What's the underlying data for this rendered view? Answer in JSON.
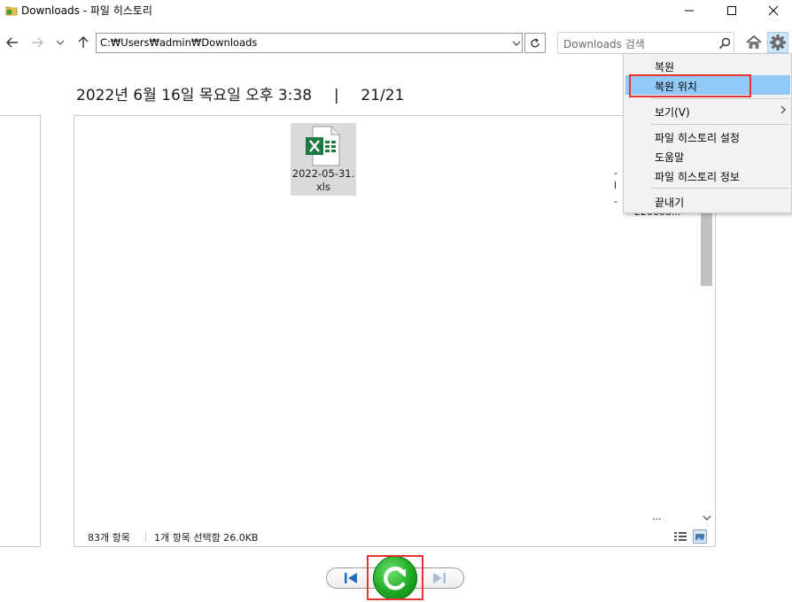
{
  "window": {
    "title": "Downloads - 파일 히스토리"
  },
  "nav": {
    "address": "C:₩Users₩admin₩Downloads",
    "search_placeholder": "Downloads 검색"
  },
  "heading": {
    "date": "2022년 6월 16일 목요일 오후 3:38",
    "separator": "|",
    "position": "21/21"
  },
  "files": [
    {
      "name": "2022-05-31.xls",
      "type": "excel-icon"
    }
  ],
  "partial_right_item": {
    "line1": "-",
    "line2": "l",
    "line3": "-",
    "line4": "220608...",
    "bottom": "..."
  },
  "status": {
    "count": "83개 항목",
    "selected": "1개 항목 선택함 26.0KB"
  },
  "context_menu": {
    "items": [
      {
        "label": "복원"
      },
      {
        "label": "복원 위치"
      },
      {
        "label": "보기(V)"
      },
      {
        "label": "파일 히스토리 설정"
      },
      {
        "label": "도움말"
      },
      {
        "label": "파일 히스토리 정보"
      },
      {
        "label": "끝내기"
      }
    ]
  },
  "colors": {
    "menu_highlight": "#91c9f7",
    "annotation_red": "#e53333",
    "restore_green": "#1eaa22",
    "nav_blue": "#1e6fc0"
  }
}
